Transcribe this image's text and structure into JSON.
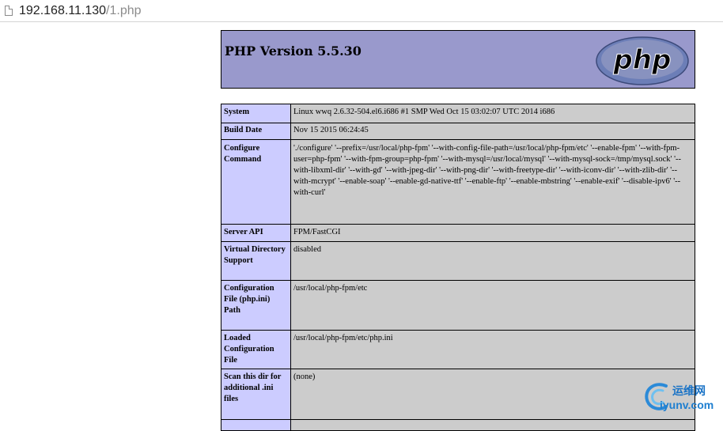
{
  "browser": {
    "url_host": "192.168.11.130",
    "url_path": "/1.php",
    "page_icon": "page-icon"
  },
  "header": {
    "title": "PHP Version 5.5.30",
    "logo_text": "php",
    "colors": {
      "header_bg": "#9999cc",
      "label_bg": "#ccccff",
      "value_bg": "#cccccc"
    }
  },
  "rows": [
    {
      "label": "System",
      "value": "Linux wwq 2.6.32-504.el6.i686 #1 SMP Wed Oct 15 03:02:07 UTC 2014 i686"
    },
    {
      "label": "Build Date",
      "value": "Nov 15 2015 06:24:45"
    },
    {
      "label": "Configure Command",
      "value": "'./configure' '--prefix=/usr/local/php-fpm' '--with-config-file-path=/usr/local/php-fpm/etc' '--enable-fpm' '--with-fpm-user=php-fpm' '--with-fpm-group=php-fpm' '--with-mysql=/usr/local/mysql' '--with-mysql-sock=/tmp/mysql.sock' '--with-libxml-dir' '--with-gd' '--with-jpeg-dir' '--with-png-dir' '--with-freetype-dir' '--with-iconv-dir' '--with-zlib-dir' '--with-mcrypt' '--enable-soap' '--enable-gd-native-ttf' '--enable-ftp' '--enable-mbstring' '--enable-exif' '--disable-ipv6' '--with-curl'"
    },
    {
      "label": "Server API",
      "value": "FPM/FastCGI"
    },
    {
      "label": "Virtual Directory Support",
      "value": "disabled"
    },
    {
      "label": "Configuration File (php.ini) Path",
      "value": "/usr/local/php-fpm/etc"
    },
    {
      "label": "Loaded Configuration File",
      "value": "/usr/local/php-fpm/etc/php.ini"
    },
    {
      "label": "Scan this dir for additional .ini files",
      "value": "(none)"
    }
  ],
  "watermark": {
    "cn_text": "运维网",
    "en_text": "iyunv.com"
  }
}
